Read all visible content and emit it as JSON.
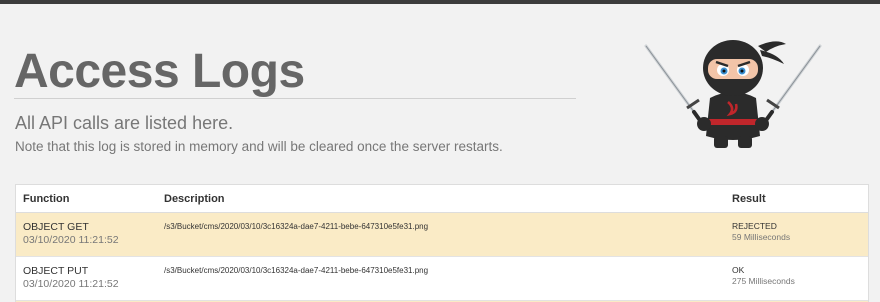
{
  "page": {
    "title": "Access Logs",
    "subtitle": "All API calls are listed here.",
    "note": "Note that this log is stored in memory and will be cleared once the server restarts."
  },
  "mascot": {
    "icon": "ninja-mascot-icon"
  },
  "table": {
    "columns": [
      "Function",
      "Description",
      "Result"
    ],
    "rows": [
      {
        "function": "OBJECT GET",
        "timestamp": "03/10/2020 11:21:52",
        "description": "/s3/Bucket/cms/2020/03/10/3c16324a-dae7-4211-bebe-647310e5fe31.png",
        "status": "REJECTED",
        "duration": "59 Milliseconds",
        "highlight_color": "#faebc6"
      },
      {
        "function": "OBJECT PUT",
        "timestamp": "03/10/2020 11:21:52",
        "description": "/s3/Bucket/cms/2020/03/10/3c16324a-dae7-4211-bebe-647310e5fe31.png",
        "status": "OK",
        "duration": "275 Milliseconds",
        "highlight_color": "#ffffff"
      }
    ]
  },
  "colors": {
    "top_bar": "#3c3c3c",
    "background": "#f2f2f2",
    "rejected_row": "#faebc6",
    "title_text": "#666666"
  }
}
